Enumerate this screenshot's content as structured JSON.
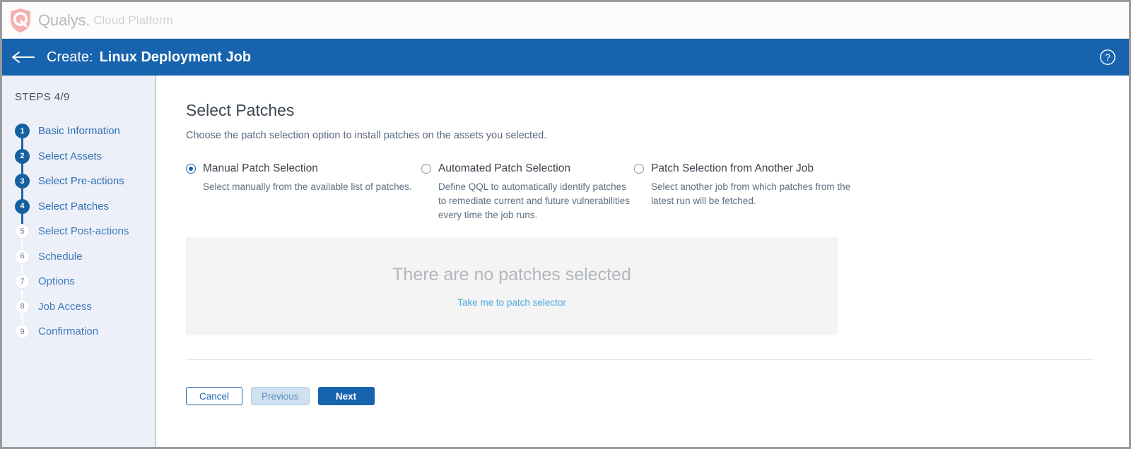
{
  "brand": {
    "logo_icon": "qualys-shield-logo",
    "name": "Qualys.",
    "product": "Cloud Platform",
    "logo_color": "#f3b0ad"
  },
  "header": {
    "back_icon": "back-arrow-icon",
    "prefix": "Create:",
    "title": "Linux Deployment Job",
    "help_icon": "help-circle-icon",
    "background_color": "#1763ae"
  },
  "sidebar": {
    "steps_label": "STEPS 4/9",
    "items": [
      {
        "num": "1",
        "label": "Basic Information",
        "state": "done"
      },
      {
        "num": "2",
        "label": "Select Assets",
        "state": "done"
      },
      {
        "num": "3",
        "label": "Select Pre-actions",
        "state": "done"
      },
      {
        "num": "4",
        "label": "Select Patches",
        "state": "done"
      },
      {
        "num": "5",
        "label": "Select Post-actions",
        "state": "todo"
      },
      {
        "num": "6",
        "label": "Schedule",
        "state": "todo"
      },
      {
        "num": "7",
        "label": "Options",
        "state": "todo"
      },
      {
        "num": "8",
        "label": "Job Access",
        "state": "todo"
      },
      {
        "num": "9",
        "label": "Confirmation",
        "state": "todo"
      }
    ]
  },
  "main": {
    "title": "Select Patches",
    "subtitle": "Choose the patch selection option to install patches on the assets you selected.",
    "options": [
      {
        "label": "Manual Patch Selection",
        "description": "Select manually from the available list of patches.",
        "selected": true
      },
      {
        "label": "Automated Patch Selection",
        "description": "Define QQL to automatically identify patches to remediate current and future vulnerabilities every time the job runs.",
        "selected": false
      },
      {
        "label": "Patch Selection from Another Job",
        "description": "Select another job from which patches from the latest run will be fetched.",
        "selected": false
      }
    ],
    "empty_state": {
      "message": "There are no patches selected",
      "link": "Take me to patch selector"
    }
  },
  "footer": {
    "cancel_label": "Cancel",
    "previous_label": "Previous",
    "next_label": "Next"
  }
}
